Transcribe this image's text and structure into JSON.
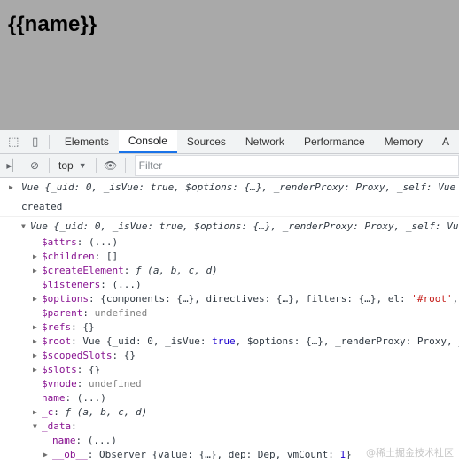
{
  "page": {
    "heading": "{{name}}"
  },
  "devtools": {
    "tabs": [
      "Elements",
      "Console",
      "Sources",
      "Network",
      "Performance",
      "Memory",
      "A"
    ],
    "active_tab": "Console",
    "context": "top",
    "filter_placeholder": "Filter"
  },
  "console": {
    "row1": "Vue {_uid: 0, _isVue: true, $options: {…}, _renderProxy: Proxy, _self: Vue",
    "row2": "created",
    "row3": "Vue {_uid: 0, _isVue: true, $options: {…}, _renderProxy: Proxy, _self: Vue",
    "props": [
      {
        "key": "$attrs",
        "sep": ": ",
        "val": "(...)",
        "vclass": ""
      },
      {
        "key": "$children",
        "sep": ": ",
        "val": "[]",
        "vclass": ""
      },
      {
        "key": "$createElement",
        "sep": ": ",
        "val": "ƒ (a, b, c, d)",
        "vclass": "i"
      },
      {
        "key": "$listeners",
        "sep": ": ",
        "val": "(...)",
        "vclass": ""
      },
      {
        "key": "$options",
        "sep": ": ",
        "val": "{components: {…}, directives: {…}, filters: {…}, el: ",
        "val2": "'#root'",
        "val3": ",",
        "vclass": ""
      },
      {
        "key": "$parent",
        "sep": ": ",
        "val": "undefined",
        "vclass": "d"
      },
      {
        "key": "$refs",
        "sep": ": ",
        "val": "{}",
        "vclass": ""
      },
      {
        "key": "$root",
        "sep": ": ",
        "val": "Vue {_uid: 0, _isVue: ",
        "val2": "true",
        "val3": ", $options: {…}, _renderProxy: Proxy, _",
        "vclass": ""
      },
      {
        "key": "$scopedSlots",
        "sep": ": ",
        "val": "{}",
        "vclass": ""
      },
      {
        "key": "$slots",
        "sep": ": ",
        "val": "{}",
        "vclass": ""
      },
      {
        "key": "$vnode",
        "sep": ": ",
        "val": "undefined",
        "vclass": "d"
      },
      {
        "key": "name",
        "sep": ": ",
        "val": "(...)",
        "vclass": ""
      },
      {
        "key": "_c",
        "sep": ": ",
        "val": "ƒ (a, b, c, d)",
        "vclass": "i"
      },
      {
        "key": "_data",
        "sep": ":",
        "val": "",
        "vclass": ""
      }
    ],
    "data_children": [
      {
        "key": "name",
        "sep": ": ",
        "val": "(...)"
      },
      {
        "key": "__ob__",
        "sep": ": ",
        "val": "Observer {value: {…}, dep: Dep, vmCount: ",
        "val2": "1",
        "val3": "}"
      }
    ]
  },
  "watermark": "@稀土掘金技术社区"
}
